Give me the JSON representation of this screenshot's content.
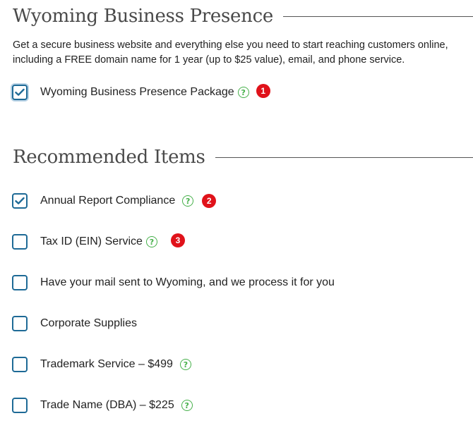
{
  "presence": {
    "title": "Wyoming Business Presence",
    "description": "Get a secure business website and everything else you need to start reaching customers online, including a FREE domain name for 1 year (up to $25 value), email, and phone service.",
    "package": {
      "label": "Wyoming Business Presence Package",
      "checked": true,
      "badge": "1",
      "help": "?"
    }
  },
  "recommended": {
    "title": "Recommended Items",
    "items": [
      {
        "label": "Annual Report Compliance",
        "checked": true,
        "help": "?",
        "badge": "2"
      },
      {
        "label": "Tax ID (EIN) Service",
        "checked": false,
        "help": "?",
        "badge": "3"
      },
      {
        "label": "Have your mail sent to Wyoming, and we process it for you",
        "checked": false
      },
      {
        "label": "Corporate Supplies",
        "checked": false
      },
      {
        "label": "Trademark Service – $499",
        "checked": false,
        "help": "?"
      },
      {
        "label": "Trade Name (DBA) – $225",
        "checked": false,
        "help": "?"
      }
    ]
  },
  "colors": {
    "checkbox_border": "#1e6a96",
    "help_icon": "#46b04a",
    "badge": "#e0121a"
  }
}
